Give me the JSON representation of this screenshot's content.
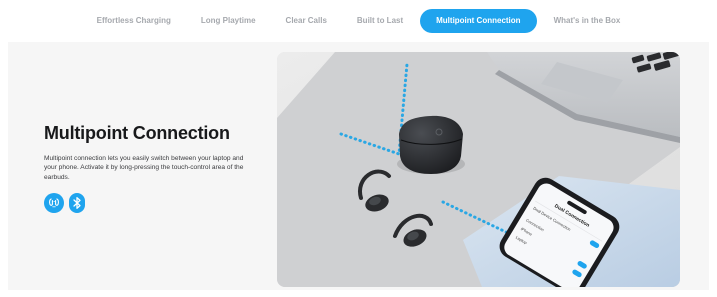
{
  "tabs": [
    {
      "label": "Effortless Charging",
      "active": false
    },
    {
      "label": "Long Playtime",
      "active": false
    },
    {
      "label": "Clear Calls",
      "active": false
    },
    {
      "label": "Built to Last",
      "active": false
    },
    {
      "label": "Multipoint Connection",
      "active": true
    },
    {
      "label": "What's in the Box",
      "active": false
    }
  ],
  "feature": {
    "title": "Multipoint Connection",
    "description": "Multipoint connection lets you easily switch between your laptop and your phone. Activate it by long-pressing the touch-control area of the earbuds.",
    "icons": [
      "dual-device-icon",
      "bluetooth-icon"
    ]
  },
  "phone_screen": {
    "header": "Dual Connection",
    "rows": [
      "Dual Device Connection",
      "Connection",
      "iPhone",
      "Laptop"
    ]
  },
  "colors": {
    "accent": "#1fa4ee",
    "title": "#18191b",
    "tab_inactive": "#a6a9ae",
    "stage_bg": "#f6f6f6"
  }
}
